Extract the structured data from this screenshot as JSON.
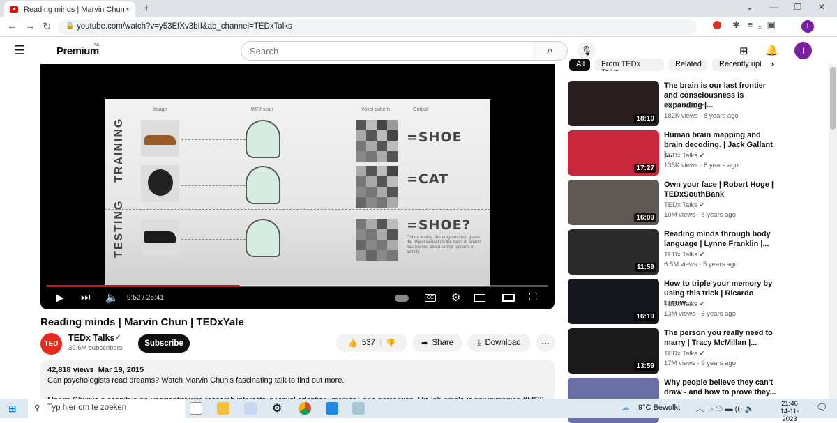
{
  "browser": {
    "tab_title": "Reading minds | Marvin Chun | TEDxYale",
    "url": "youtube.com/watch?v=y53EfXv3bII&ab_channel=TEDxTalks",
    "new_tab": "+",
    "close": "×"
  },
  "header": {
    "logo": "Premium",
    "region": "NL",
    "search_placeholder": "Search",
    "avatar_letter": "I"
  },
  "chips": [
    "All",
    "From TEDx Talks",
    "Related",
    "Recently uploaded"
  ],
  "slide": {
    "col_image": "Image",
    "col_fmri": "fMRI scan",
    "col_voxel": "Voxel pattern",
    "col_output": "Output",
    "training": "TRAINING",
    "testing": "TESTING",
    "out1": "=SHOE",
    "out2": "=CAT",
    "out3": "=SHOE?",
    "note": "During testing, the program must guess the object viewed on the basis of what it has learned about similar patterns of activity."
  },
  "player": {
    "time": "9:52 / 25:41",
    "progress": 0.384
  },
  "video": {
    "title": "Reading minds | Marvin Chun | TEDxYale",
    "channel": "TEDx Talks",
    "avatar_text": "TED",
    "subscribers": "39.6M subscribers",
    "subscribe": "Subscribe",
    "likes": "537",
    "share": "Share",
    "download": "Download",
    "more": "⋯",
    "views": "42,818 views",
    "date": "Mar 19, 2015",
    "desc1": "Can psychologists read dreams? Watch Marvin Chun's fascinating talk to find out more.",
    "desc2": "Marvin Chun is a cognitive neuroscientist with research interests in visual attention, memory, and perception. His lab employs neuroimaging (fMRI)"
  },
  "recommendations": [
    {
      "title": "The brain is our last frontier and consciousness is expanding |...",
      "channel": "TEDx Talks",
      "views": "182K views",
      "age": "8 years ago",
      "duration": "18:10",
      "color": "#2a1f1f"
    },
    {
      "title": "Human brain mapping and brain decoding. | Jack Gallant |...",
      "channel": "TEDx Talks",
      "views": "135K views",
      "age": "6 years ago",
      "duration": "17:27",
      "color": "#c8263a"
    },
    {
      "title": "Own your face | Robert Hoge | TEDxSouthBank",
      "channel": "TEDx Talks",
      "views": "10M views",
      "age": "8 years ago",
      "duration": "16:09",
      "color": "#5e5752"
    },
    {
      "title": "Reading minds through body language | Lynne Franklin |...",
      "channel": "TEDx Talks",
      "views": "6.5M views",
      "age": "5 years ago",
      "duration": "11:59",
      "color": "#2b2b2b"
    },
    {
      "title": "How to triple your memory by using this trick | Ricardo Lieuw...",
      "channel": "TEDx Talks",
      "views": "13M views",
      "age": "5 years ago",
      "duration": "16:19",
      "color": "#15181f"
    },
    {
      "title": "The person you really need to marry | Tracy McMillan |...",
      "channel": "TEDx Talks",
      "views": "17M views",
      "age": "9 years ago",
      "duration": "13:59",
      "color": "#1a1a1a"
    },
    {
      "title": "Why people believe they can't draw - and how to prove they...",
      "channel": "",
      "views": "",
      "age": "",
      "duration": "",
      "color": "#6a6fa8"
    }
  ],
  "taskbar": {
    "search_placeholder": "Typ hier om te zoeken",
    "weather": "9°C Bewolkt",
    "time": "21:46",
    "date": "14-11-2023"
  }
}
